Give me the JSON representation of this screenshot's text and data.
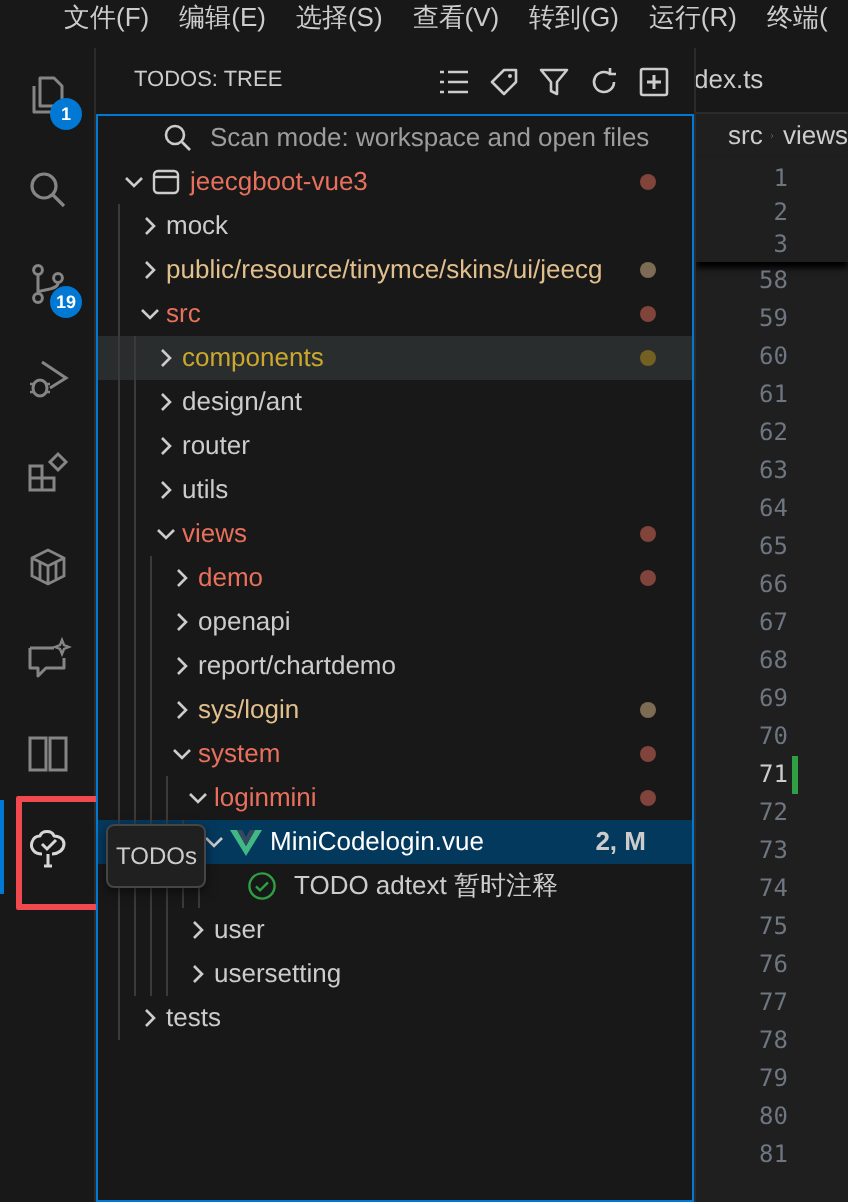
{
  "menu": [
    {
      "label": "文件(F)"
    },
    {
      "label": "编辑(E)"
    },
    {
      "label": "选择(S)"
    },
    {
      "label": "查看(V)"
    },
    {
      "label": "转到(G)"
    },
    {
      "label": "运行(R)"
    },
    {
      "label": "终端("
    }
  ],
  "activity_bar": [
    {
      "kind": "files",
      "badge": "1",
      "selected": false
    },
    {
      "kind": "search",
      "selected": false
    },
    {
      "kind": "source-control",
      "badge": "19",
      "selected": false
    },
    {
      "kind": "run-debug",
      "selected": false
    },
    {
      "kind": "extensions",
      "selected": false
    },
    {
      "kind": "box",
      "selected": false
    },
    {
      "kind": "chat",
      "selected": false
    },
    {
      "kind": "book",
      "selected": false
    },
    {
      "kind": "todo-tree",
      "selected": true,
      "highlighted": true
    }
  ],
  "tooltip": {
    "text": "TODOs"
  },
  "sidebar": {
    "title": "TODOS: TREE",
    "toolbar": [
      {
        "kind": "list"
      },
      {
        "kind": "tag"
      },
      {
        "kind": "filter"
      },
      {
        "kind": "refresh"
      },
      {
        "kind": "add"
      }
    ],
    "scan_mode": "Scan mode: workspace and open files",
    "tree": [
      {
        "label": "jeecgboot-vue3",
        "kind": "root",
        "expanded": true,
        "color": "#e8705c",
        "dot": true,
        "selected": false,
        "hovered": false,
        "children": [
          {
            "label": "mock",
            "kind": "folder",
            "expanded": false,
            "selected": false,
            "hovered": false
          },
          {
            "label": "public/resource/tinymce/skins/ui/jeecg",
            "kind": "folder",
            "expanded": false,
            "color": "#e2c08d",
            "dot": true,
            "selected": false,
            "hovered": false
          },
          {
            "label": "src",
            "kind": "folder",
            "expanded": true,
            "color": "#e8705c",
            "dot": true,
            "selected": false,
            "hovered": false,
            "children": [
              {
                "label": "components",
                "kind": "folder",
                "expanded": false,
                "color": "#cca92c",
                "dot": true,
                "selected": false,
                "hovered": true
              },
              {
                "label": "design/ant",
                "kind": "folder",
                "expanded": false,
                "selected": false,
                "hovered": false
              },
              {
                "label": "router",
                "kind": "folder",
                "expanded": false,
                "selected": false,
                "hovered": false
              },
              {
                "label": "utils",
                "kind": "folder",
                "expanded": false,
                "selected": false,
                "hovered": false
              },
              {
                "label": "views",
                "kind": "folder",
                "expanded": true,
                "color": "#e8705c",
                "dot": true,
                "selected": false,
                "hovered": false,
                "children": [
                  {
                    "label": "demo",
                    "kind": "folder",
                    "expanded": false,
                    "color": "#e8705c",
                    "dot": true,
                    "selected": false,
                    "hovered": false
                  },
                  {
                    "label": "openapi",
                    "kind": "folder",
                    "expanded": false,
                    "selected": false,
                    "hovered": false
                  },
                  {
                    "label": "report/chartdemo",
                    "kind": "folder",
                    "expanded": false,
                    "selected": false,
                    "hovered": false
                  },
                  {
                    "label": "sys/login",
                    "kind": "folder",
                    "expanded": false,
                    "color": "#e2c08d",
                    "dot": true,
                    "selected": false,
                    "hovered": false
                  },
                  {
                    "label": "system",
                    "kind": "folder",
                    "expanded": true,
                    "color": "#e8705c",
                    "dot": true,
                    "selected": false,
                    "hovered": false,
                    "children": [
                      {
                        "label": "loginmini",
                        "kind": "folder",
                        "expanded": true,
                        "color": "#e8705c",
                        "dot": true,
                        "selected": false,
                        "hovered": false,
                        "children": [
                          {
                            "label": "MiniCodelogin.vue",
                            "kind": "file",
                            "expanded": true,
                            "badge": "2, M",
                            "selected": true,
                            "hovered": false,
                            "children": [
                              {
                                "label": "TODO adtext 暂时注释",
                                "kind": "todo",
                                "selected": false,
                                "hovered": false
                              }
                            ]
                          }
                        ]
                      },
                      {
                        "label": "user",
                        "kind": "folder",
                        "expanded": false,
                        "selected": false,
                        "hovered": false
                      },
                      {
                        "label": "usersetting",
                        "kind": "folder",
                        "expanded": false,
                        "selected": false,
                        "hovered": false
                      }
                    ]
                  }
                ]
              }
            ]
          },
          {
            "label": "tests",
            "kind": "folder",
            "expanded": false,
            "selected": false,
            "hovered": false
          }
        ]
      }
    ]
  },
  "editor": {
    "tab": "dex.ts",
    "breadcrumb": [
      "src",
      "views"
    ],
    "lines": [
      {
        "number": "1",
        "kind": "sticky",
        "current": false,
        "modified": false
      },
      {
        "number": "2",
        "kind": "sticky",
        "current": false,
        "modified": false
      },
      {
        "number": "3",
        "kind": "sticky",
        "current": false,
        "modified": false
      },
      {
        "number": "58",
        "kind": "normal",
        "current": false,
        "modified": false
      },
      {
        "number": "59",
        "kind": "normal",
        "current": false,
        "modified": false
      },
      {
        "number": "60",
        "kind": "normal",
        "current": false,
        "modified": false
      },
      {
        "number": "61",
        "kind": "normal",
        "current": false,
        "modified": false
      },
      {
        "number": "62",
        "kind": "normal",
        "current": false,
        "modified": false
      },
      {
        "number": "63",
        "kind": "normal",
        "current": false,
        "modified": false
      },
      {
        "number": "64",
        "kind": "normal",
        "current": false,
        "modified": false
      },
      {
        "number": "65",
        "kind": "normal",
        "current": false,
        "modified": false
      },
      {
        "number": "66",
        "kind": "normal",
        "current": false,
        "modified": false
      },
      {
        "number": "67",
        "kind": "normal",
        "current": false,
        "modified": false
      },
      {
        "number": "68",
        "kind": "normal",
        "current": false,
        "modified": false
      },
      {
        "number": "69",
        "kind": "normal",
        "current": false,
        "modified": false
      },
      {
        "number": "70",
        "kind": "normal",
        "current": false,
        "modified": false
      },
      {
        "number": "71",
        "kind": "normal",
        "current": true,
        "modified": true
      },
      {
        "number": "72",
        "kind": "normal",
        "current": false,
        "modified": false
      },
      {
        "number": "73",
        "kind": "normal",
        "current": false,
        "modified": false
      },
      {
        "number": "74",
        "kind": "normal",
        "current": false,
        "modified": false
      },
      {
        "number": "75",
        "kind": "normal",
        "current": false,
        "modified": false
      },
      {
        "number": "76",
        "kind": "normal",
        "current": false,
        "modified": false
      },
      {
        "number": "77",
        "kind": "normal",
        "current": false,
        "modified": false
      },
      {
        "number": "78",
        "kind": "normal",
        "current": false,
        "modified": false
      },
      {
        "number": "79",
        "kind": "normal",
        "current": false,
        "modified": false
      },
      {
        "number": "80",
        "kind": "normal",
        "current": false,
        "modified": false
      },
      {
        "number": "81",
        "kind": "normal",
        "current": false,
        "modified": false
      }
    ]
  }
}
